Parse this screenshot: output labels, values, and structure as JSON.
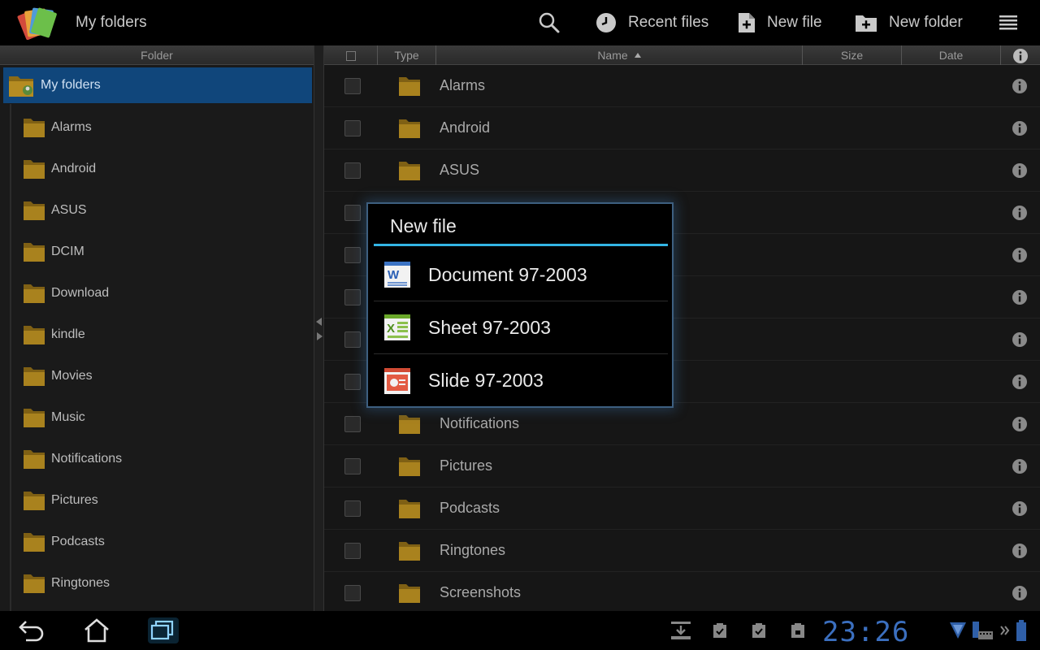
{
  "actionbar": {
    "title": "My folders",
    "search_icon": "search-icon",
    "recent_label": "Recent files",
    "newfile_label": "New file",
    "newfolder_label": "New folder"
  },
  "left_pane": {
    "header": "Folder",
    "root_label": "My folders",
    "items": [
      "Alarms",
      "Android",
      "ASUS",
      "DCIM",
      "Download",
      "kindle",
      "Movies",
      "Music",
      "Notifications",
      "Pictures",
      "Podcasts",
      "Ringtones"
    ]
  },
  "columns": {
    "type": "Type",
    "name": "Name",
    "size": "Size",
    "date": "Date"
  },
  "files": [
    {
      "name": "Alarms"
    },
    {
      "name": "Android"
    },
    {
      "name": "ASUS"
    },
    {
      "name": ""
    },
    {
      "name": ""
    },
    {
      "name": ""
    },
    {
      "name": ""
    },
    {
      "name": ""
    },
    {
      "name": "Notifications"
    },
    {
      "name": "Pictures"
    },
    {
      "name": "Podcasts"
    },
    {
      "name": "Ringtones"
    },
    {
      "name": "Screenshots"
    }
  ],
  "dialog": {
    "title": "New file",
    "options": [
      "Document 97-2003",
      "Sheet 97-2003",
      "Slide 97-2003"
    ]
  },
  "system_bar": {
    "clock": "23:26"
  },
  "colors": {
    "accent": "#33b5e5",
    "selection": "#10467b",
    "folder": "#a07a18",
    "clock": "#3b6fbf"
  }
}
